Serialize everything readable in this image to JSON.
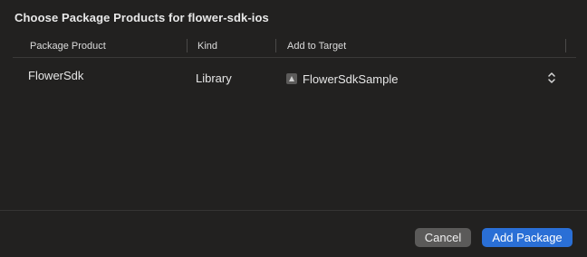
{
  "dialog": {
    "title": "Choose Package Products for flower-sdk-ios"
  },
  "table": {
    "columns": [
      "Package Product",
      "Kind",
      "Add to Target"
    ],
    "rows": [
      {
        "product": "FlowerSdk",
        "kind": "Library",
        "target": "FlowerSdkSample",
        "target_icon": "app-target-icon"
      }
    ]
  },
  "buttons": {
    "cancel": "Cancel",
    "add": "Add Package"
  },
  "colors": {
    "primary_button": "#2a6fd6",
    "secondary_button": "#5b5a59",
    "background": "#222120"
  }
}
